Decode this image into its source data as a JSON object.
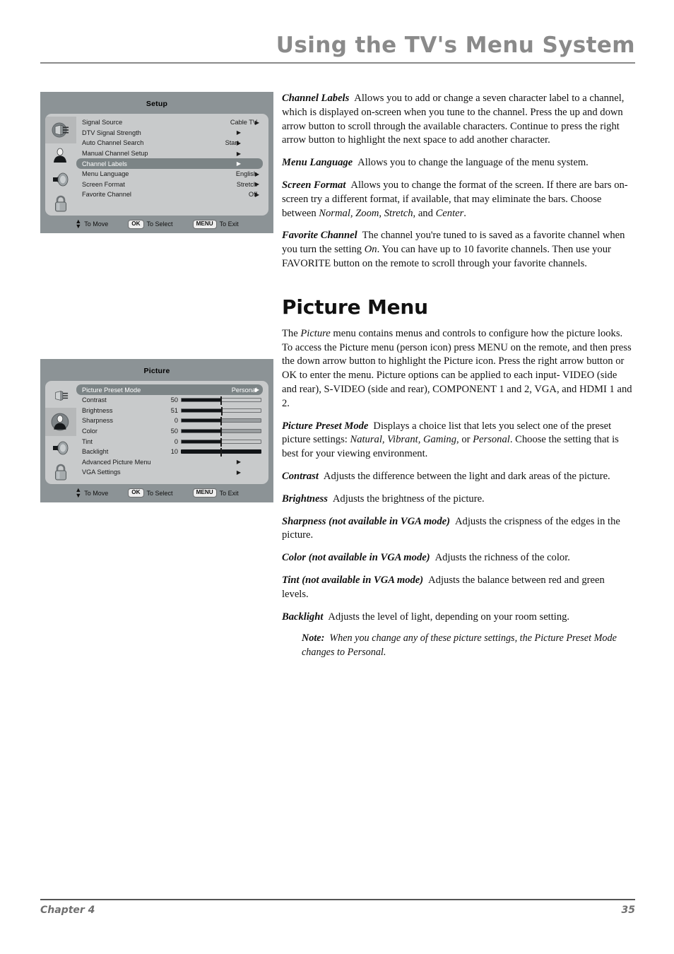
{
  "header": {
    "title": "Using the TV's Menu System"
  },
  "footer": {
    "chapter": "Chapter 4",
    "page_number": "35"
  },
  "colors": {
    "header_gray": "#8a8a8a",
    "osd_frame": "#8c9396",
    "osd_panel": "#c8cacb",
    "osd_highlight": "#7c8486",
    "slider_fill": "#111417"
  },
  "setup_menu": {
    "title": "Setup",
    "icons": [
      {
        "name": "connector-icon",
        "selected": true
      },
      {
        "name": "person-icon",
        "selected": false
      },
      {
        "name": "speaker-icon",
        "selected": false
      },
      {
        "name": "padlock-icon",
        "selected": false
      }
    ],
    "rows": [
      {
        "label": "Signal Source",
        "value": "Cable TV",
        "arrow": "▶",
        "highlighted": false
      },
      {
        "label": "DTV Signal Strength",
        "value": "",
        "arrow": "▶",
        "highlighted": false
      },
      {
        "label": "Auto Channel Search",
        "value": "Start",
        "arrow": "▶",
        "highlighted": false
      },
      {
        "label": "Manual Channel Setup",
        "value": "",
        "arrow": "▶",
        "highlighted": false
      },
      {
        "label": "Channel Labels",
        "value": "",
        "arrow": "▶",
        "highlighted": true
      },
      {
        "label": "Menu Language",
        "value": "English",
        "arrow": "▶",
        "highlighted": false
      },
      {
        "label": "Screen Format",
        "value": "Stretch",
        "arrow": "▶",
        "highlighted": false
      },
      {
        "label": "Favorite Channel",
        "value": "Off",
        "arrow": "▶",
        "highlighted": false
      }
    ],
    "footer": {
      "move_label": "To Move",
      "ok_key": "OK",
      "select_label": "To Select",
      "menu_key": "MENU",
      "exit_label": "To Exit"
    }
  },
  "picture_menu": {
    "title": "Picture",
    "icons": [
      {
        "name": "connector-icon",
        "selected": false
      },
      {
        "name": "person-icon",
        "selected": true
      },
      {
        "name": "speaker-icon",
        "selected": false
      },
      {
        "name": "padlock-icon",
        "selected": false
      }
    ],
    "rows": [
      {
        "label": "Picture Preset Mode",
        "value": "Personal",
        "arrow": "▶",
        "highlighted": true,
        "type": "value"
      },
      {
        "label": "Contrast",
        "number": "50",
        "type": "slider",
        "fill_pct": 50,
        "rest": "white"
      },
      {
        "label": "Brightness",
        "number": "51",
        "type": "slider",
        "fill_pct": 51,
        "rest": "white"
      },
      {
        "label": "Sharpness",
        "number": "0",
        "type": "slider",
        "fill_pct": 50,
        "rest": "gray"
      },
      {
        "label": "Color",
        "number": "50",
        "type": "slider",
        "fill_pct": 50,
        "rest": "gray"
      },
      {
        "label": "Tint",
        "number": "0",
        "type": "slider",
        "fill_pct": 50,
        "rest": "white"
      },
      {
        "label": "Backlight",
        "number": "10",
        "type": "slider",
        "fill_pct": 100,
        "rest": "none"
      },
      {
        "label": "Advanced Picture Menu",
        "value": "",
        "arrow": "▶",
        "highlighted": false,
        "type": "value"
      },
      {
        "label": "VGA Settings",
        "value": "",
        "arrow": "▶",
        "highlighted": false,
        "type": "value"
      }
    ],
    "footer": {
      "move_label": "To Move",
      "ok_key": "OK",
      "select_label": "To Select",
      "menu_key": "MENU",
      "exit_label": "To Exit"
    }
  },
  "content": {
    "channel_labels": {
      "term": "Channel Labels",
      "text": "Allows you to add or change a seven character label to a channel, which is displayed on-screen when you tune to the channel. Press the up and down arrow button to scroll through the available characters. Continue to press the right arrow button to highlight the next space to add another character."
    },
    "menu_language": {
      "term": "Menu Language",
      "text": "Allows you to change the language of the menu system."
    },
    "screen_format": {
      "term": "Screen Format",
      "text_a": "Allows you to change the format of the screen. If there are bars on-screen try a different format, if available, that may eliminate the bars. Choose between ",
      "options": "Normal, Zoom, Stretch",
      "text_b": ", and ",
      "option_last": "Center",
      "text_c": "."
    },
    "favorite_channel": {
      "term": "Favorite Channel",
      "text_a": "The channel you're tuned to is saved as a favorite channel when you turn the setting ",
      "on_word": "On",
      "text_b": ". You can have up to 10 favorite channels. Then use your FAVORITE button on the remote to scroll through your favorite channels."
    },
    "picture_menu_heading": "Picture Menu",
    "picture_intro": {
      "text_a": "The ",
      "ital": "Picture",
      "text_b": " menu contains menus and controls to configure how the picture looks. To access the Picture menu (person icon) press MENU on the remote, and then press the down arrow button to highlight the Picture icon. Press the right arrow button or OK to enter the menu. Picture options can be applied to each input- VIDEO (side and rear), S-VIDEO (side and rear), COMPONENT 1 and 2, VGA, and HDMI 1 and 2."
    },
    "picture_preset_mode": {
      "term": "Picture Preset Mode",
      "text_a": "Displays a choice list that lets you select one of the preset picture settings: ",
      "options": "Natural, Vibrant, Gaming",
      "text_b": ", or ",
      "option_last": "Personal",
      "text_c": ". Choose the setting that is best for your viewing environment."
    },
    "contrast": {
      "term": "Contrast",
      "text": "Adjusts the difference between the light and dark areas of the picture."
    },
    "brightness": {
      "term": "Brightness",
      "text": "Adjusts the brightness of the picture."
    },
    "sharpness": {
      "term": "Sharpness (not available in VGA mode)",
      "text": "Adjusts the crispness of the edges in the picture."
    },
    "color": {
      "term": "Color (not available in VGA mode)",
      "text": "Adjusts the richness of the color."
    },
    "tint": {
      "term": "Tint (not available in VGA mode)",
      "text": "Adjusts the balance between red and green levels."
    },
    "backlight": {
      "term": "Backlight",
      "text": "Adjusts the level of light, depending on your room setting."
    },
    "note": {
      "label": "Note:",
      "text": "When you change any of these picture settings, the Picture Preset Mode changes to Personal."
    }
  }
}
